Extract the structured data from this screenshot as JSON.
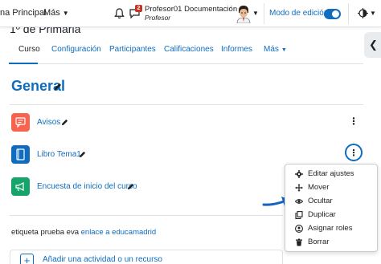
{
  "navbar": {
    "home_label": "na Principal",
    "more_label": "Más",
    "messages_badge": "2",
    "user_name": "Profesor01 Documentación",
    "user_role": "Profesor",
    "edit_mode_label": "Modo de edición",
    "edit_mode_on": true
  },
  "header": {
    "partial_title": "1º de Primaria"
  },
  "tabs": [
    {
      "label": "Curso",
      "active": true
    },
    {
      "label": "Configuración"
    },
    {
      "label": "Participantes"
    },
    {
      "label": "Calificaciones"
    },
    {
      "label": "Informes"
    },
    {
      "label": "Más"
    }
  ],
  "section": {
    "title": "General"
  },
  "activities": [
    {
      "label": "Avisos",
      "icon": "forum-icon",
      "color": "#f7634d"
    },
    {
      "label": "Libro Tema1",
      "icon": "book-icon",
      "color": "#0f6cbf"
    },
    {
      "label": "Encuesta de inicio del curso",
      "icon": "feedback-icon",
      "color": "#15a56b"
    }
  ],
  "action_menu": [
    {
      "label": "Editar ajustes",
      "icon": "gear-icon"
    },
    {
      "label": "Mover",
      "icon": "move-arrows-icon"
    },
    {
      "label": "Ocultar",
      "icon": "eye-icon"
    },
    {
      "label": "Duplicar",
      "icon": "copy-icon"
    },
    {
      "label": "Asignar roles",
      "icon": "user-icon"
    },
    {
      "label": "Borrar",
      "icon": "trash-icon"
    }
  ],
  "label_activity": {
    "text": "etiqueta prueba eva",
    "link_text": "enlace a educamadrid"
  },
  "add_activity": {
    "label": "Añadir una actividad o un recurso"
  },
  "colors": {
    "primary": "#0f6cbf",
    "forum": "#f7634d",
    "book": "#0f6cbf",
    "feedback": "#15a56b"
  }
}
